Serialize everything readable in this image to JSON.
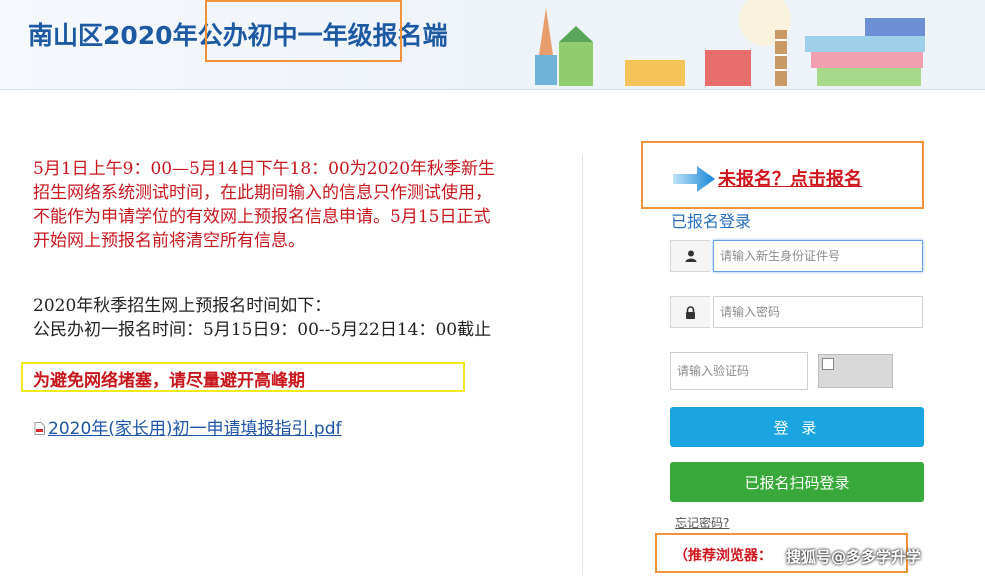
{
  "header": {
    "title": "南山区2020年公办初中一年级报名端"
  },
  "notice": {
    "test_period": "5月1日上午9：00—5月14日下午18：00为2020年秋季新生招生网络系统测试时间，在此期间输入的信息只作测试使用，不能作为申请学位的有效网上预报名信息申请。5月15日正式开始网上预报名前将清空所有信息。",
    "schedule_heading": "2020年秋季招生网上预报名时间如下：",
    "schedule_detail": "公民办初一报名时间：5月15日9：00--5月22日14：00截止",
    "warning": "为避免网络堵塞，请尽量避开高峰期",
    "guide_link": "2020年(家长用)初一申请填报指引.pdf"
  },
  "login": {
    "register_link": "未报名？点击报名",
    "title": "已报名登录",
    "id_placeholder": "请输入新生身份证件号",
    "password_placeholder": "请输入密码",
    "captcha_placeholder": "请输入验证码",
    "login_button": "登 录",
    "scan_button": "已报名扫码登录",
    "forgot_link": "忘记密码?",
    "browser_label": "（推荐浏览器："
  },
  "watermark": "搜狐号@多多学升学",
  "colors": {
    "brand_blue": "#1d5aa3",
    "notice_red": "#c8161d",
    "login_blue": "#1aa4e0",
    "scan_green": "#39a83a",
    "highlight_orange": "#f0923a",
    "highlight_yellow": "#f2ea1c"
  }
}
